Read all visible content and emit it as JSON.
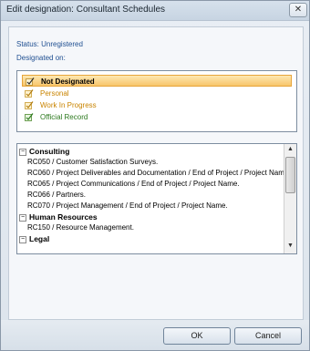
{
  "window": {
    "title": "Edit designation: Consultant Schedules",
    "close_glyph": "✕"
  },
  "status": {
    "label": "Status: Unregistered",
    "designated_label": "Designated on:"
  },
  "designations": [
    {
      "label": "Not Designated",
      "selected": true,
      "color": "#000000",
      "icon": "check-icon"
    },
    {
      "label": "Personal",
      "selected": false,
      "color": "#c98400",
      "icon": "check-icon"
    },
    {
      "label": "Work In Progress",
      "selected": false,
      "color": "#c98400",
      "icon": "check-icon"
    },
    {
      "label": "Official Record",
      "selected": false,
      "color": "#2d7a1f",
      "icon": "check-icon"
    }
  ],
  "tree": {
    "groups": [
      {
        "label": "Consulting",
        "toggle": "−",
        "items": [
          "RC050 / Customer Satisfaction Surveys.",
          "RC060 / Project Deliverables and Documentation / End of Project / Project Nam",
          "RC065 / Project Communications / End of Project / Project Name.",
          "RC066 / Partners.",
          "RC070 / Project Management / End of Project / Project Name."
        ]
      },
      {
        "label": "Human Resources",
        "toggle": "−",
        "items": [
          "RC150 / Resource Management."
        ]
      },
      {
        "label": "Legal",
        "toggle": "−",
        "items": []
      }
    ],
    "scroll_up": "▲",
    "scroll_down": "▼"
  },
  "buttons": {
    "ok": "OK",
    "cancel": "Cancel"
  }
}
